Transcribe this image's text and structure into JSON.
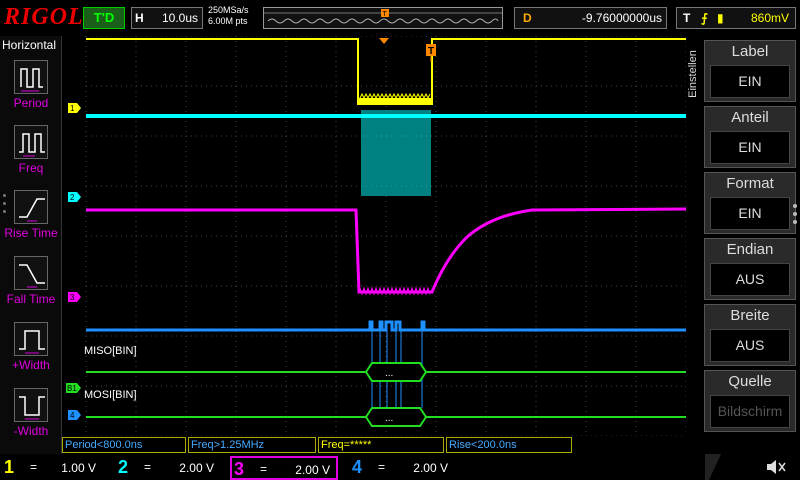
{
  "topbar": {
    "logo": "RIGOL",
    "run_state": "T'D",
    "horizontal_label": "H",
    "timebase": "10.0us",
    "sample_rate": "250MSa/s",
    "memory_depth": "6.00M pts",
    "delay_label": "D",
    "delay_value": "-9.76000000us",
    "trigger_label": "T",
    "trigger_edge_icon": "rising-edge-icon",
    "trigger_level": "860mV"
  },
  "left_menu": {
    "title": "Horizontal",
    "items": [
      {
        "label": "Period",
        "icon": "period-icon"
      },
      {
        "label": "Freq",
        "icon": "freq-icon"
      },
      {
        "label": "Rise Time",
        "icon": "rise-time-icon"
      },
      {
        "label": "Fall Time",
        "icon": "fall-time-icon"
      },
      {
        "label": "+Width",
        "icon": "positive-width-icon"
      },
      {
        "label": "-Width",
        "icon": "negative-width-icon"
      }
    ]
  },
  "right_menu": {
    "title": "Einstellen",
    "items": [
      {
        "label": "Label",
        "value": "EIN",
        "dim": false
      },
      {
        "label": "Anteil",
        "value": "EIN",
        "dim": false
      },
      {
        "label": "Format",
        "value": "EIN",
        "dim": false
      },
      {
        "label": "Endian",
        "value": "AUS",
        "dim": false
      },
      {
        "label": "Breite",
        "value": "AUS",
        "dim": false
      },
      {
        "label": "Quelle",
        "value": "Bildschirm",
        "dim": true
      }
    ]
  },
  "plot": {
    "channel_markers": [
      "1",
      "2",
      "3",
      "B1",
      "4"
    ],
    "decode_labels": [
      "MISO[BIN]",
      "MOSI[BIN]"
    ],
    "decode_values": [
      "...",
      "..."
    ],
    "colors": {
      "ch1": "#ffff00",
      "ch2": "#00ffff",
      "ch3": "#ff00ff",
      "ch4": "#1e90ff",
      "decode": "#22dd22",
      "trigger": "#ff8800"
    }
  },
  "measurements": [
    {
      "text": "Period<800.0ns"
    },
    {
      "text": "Freq>1.25MHz"
    },
    {
      "text": "Freq=*****"
    },
    {
      "text": "Rise<200.0ns"
    }
  ],
  "channels": [
    {
      "number": "1",
      "coupling": "=",
      "scale": "1.00 V",
      "color": "#ffff00"
    },
    {
      "number": "2",
      "coupling": "=",
      "scale": "2.00 V",
      "color": "#00ffff"
    },
    {
      "number": "3",
      "coupling": "=",
      "scale": "2.00 V",
      "color": "#ff00ff"
    },
    {
      "number": "4",
      "coupling": "=",
      "scale": "2.00 V",
      "color": "#1e90ff"
    }
  ],
  "status": {
    "speaker_icon": "speaker-muted-icon"
  }
}
